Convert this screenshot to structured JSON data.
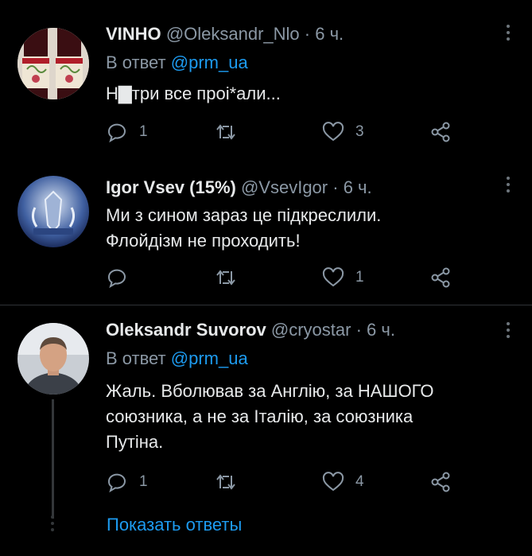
{
  "tweets": [
    {
      "name": "VINHO",
      "handle": "@Oleksandr_Nlo",
      "time": "· 6 ч.",
      "reply_prefix": "В ответ",
      "reply_handle": "@prm_ua",
      "text": "Н▇три все проі*али...",
      "replies": "1",
      "retweets": "",
      "likes": "3"
    },
    {
      "name": "Igor Vsev (15%)",
      "handle": "@VsevIgor",
      "time": "· 6 ч.",
      "text_lines": [
        "Ми з сином зараз це підкреслили.",
        "Флойдізм не проходить!"
      ],
      "replies": "",
      "retweets": "",
      "likes": "1"
    },
    {
      "name": "Oleksandr Suvorov",
      "handle": "@cryostar",
      "time": "· 6 ч.",
      "reply_prefix": "В ответ",
      "reply_handle": "@prm_ua",
      "text_lines": [
        "Жаль. Вболював за Англію, за НАШОГО",
        "союзника, а не за Італію, за союзника",
        "Путіна."
      ],
      "replies": "1",
      "retweets": "",
      "likes": "4"
    }
  ],
  "show_replies": "Показать ответы",
  "icons": {
    "reply": "reply-icon",
    "retweet": "retweet-icon",
    "like": "heart-icon",
    "share": "share-icon",
    "more": "more-vertical-icon"
  },
  "colors": {
    "background": "#000000",
    "text": "#e7e9ea",
    "muted": "#8b98a5",
    "accent": "#1d9bf0"
  }
}
